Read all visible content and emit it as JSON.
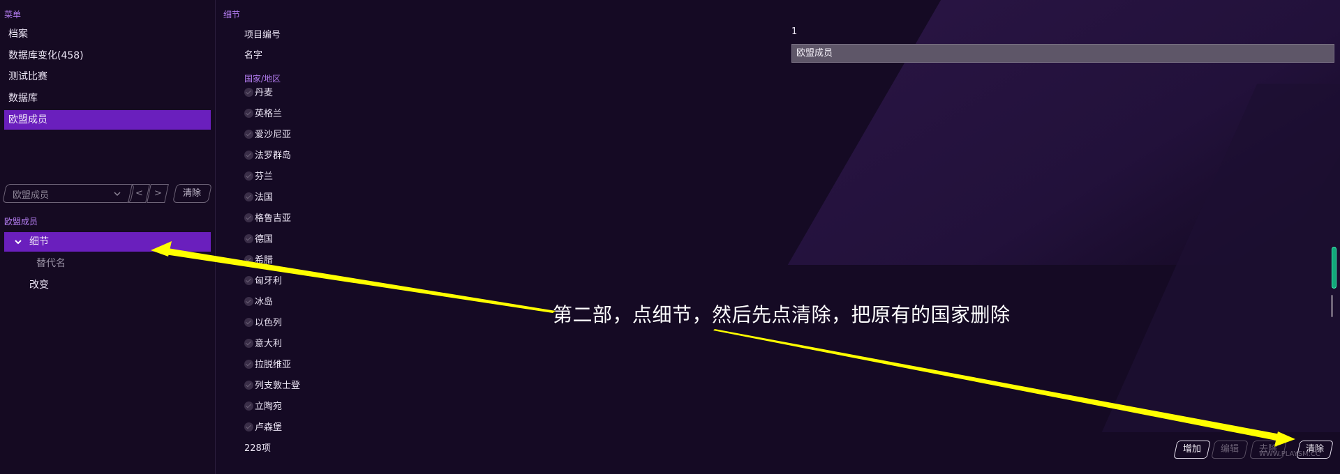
{
  "sidebar": {
    "menu_label": "菜单",
    "menu_items": [
      {
        "label": "档案",
        "active": false
      },
      {
        "label": "数据库变化(458)",
        "active": false
      },
      {
        "label": "测试比赛",
        "active": false
      },
      {
        "label": "数据库",
        "active": false
      },
      {
        "label": "欧盟成员",
        "active": true
      }
    ],
    "selector": {
      "value": "欧盟成员",
      "prev": "<",
      "next": ">",
      "clear_label": "清除"
    },
    "tree_label": "欧盟成员",
    "tree_items": [
      {
        "label": "细节",
        "active": true,
        "expanded": true
      },
      {
        "label": "替代名",
        "active": false
      },
      {
        "label": "改变",
        "active": false
      }
    ]
  },
  "main": {
    "title": "细节",
    "fields": {
      "id_label": "项目编号",
      "id_value": "1",
      "name_label": "名字",
      "name_value": "欧盟成员"
    },
    "country_header": "国家/地区",
    "countries": [
      "丹麦",
      "英格兰",
      "爱沙尼亚",
      "法罗群岛",
      "芬兰",
      "法国",
      "格鲁吉亚",
      "德国",
      "希腊",
      "匈牙利",
      "冰岛",
      "以色列",
      "意大利",
      "拉脱维亚",
      "列支敦士登",
      "立陶宛",
      "卢森堡"
    ],
    "count": "228项",
    "actions": {
      "add": "增加",
      "edit": "编辑",
      "remove": "去除",
      "clear": "清除"
    }
  },
  "annotation": {
    "text": "第二部，点细节，然后先点清除，把原有的国家删除",
    "arrow_color": "#ffff00"
  },
  "watermark": "WWW.PLAYSM.CC",
  "colors": {
    "accent": "#6a1fbd",
    "section_label": "#b37cf0",
    "background": "#150a24",
    "scrollbar": "#12a87a"
  }
}
